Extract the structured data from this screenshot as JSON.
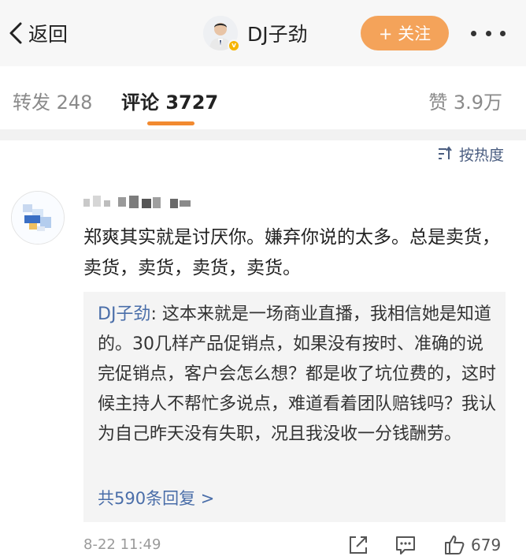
{
  "topbar": {
    "back_label": "返回",
    "author_name": "DJ子劲",
    "follow_label": "+ 关注"
  },
  "tabs": [
    {
      "label": "转发",
      "count": "248"
    },
    {
      "label": "评论",
      "count": "3727"
    },
    {
      "label": "赞",
      "count": "3.9万"
    }
  ],
  "sort": {
    "label": "按热度"
  },
  "comment": {
    "text": "郑爽其实就是讨厌你。嫌弃你说的太多。总是卖货，卖货，卖货，卖货，卖货。",
    "reply": {
      "author": "DJ子劲",
      "separator": ": ",
      "text": "这本来就是一场商业直播，我相信她是知道的。30几样产品促销点，如果没有按时、准确的说完促销点，客户会怎么想？都是收了坑位费的，这时候主持人不帮忙多说点，难道看着团队赔钱吗？我认为自己昨天没有失职，况且我没收一分钱酬劳。",
      "more_label": "共590条回复 >"
    },
    "time": "8-22 11:49",
    "like_count": "679"
  },
  "icons": {
    "back": "chevron-left-icon",
    "more": "more-dots-icon",
    "sort": "sort-icon",
    "share": "share-icon",
    "comment": "comment-icon",
    "like": "thumbs-up-icon"
  },
  "colors": {
    "accent": "#f28a30",
    "follow_button": "#f4a35a",
    "link": "#4a6ea9",
    "reply_background": "#f4f4f4",
    "verified_badge": "#f6b400"
  }
}
